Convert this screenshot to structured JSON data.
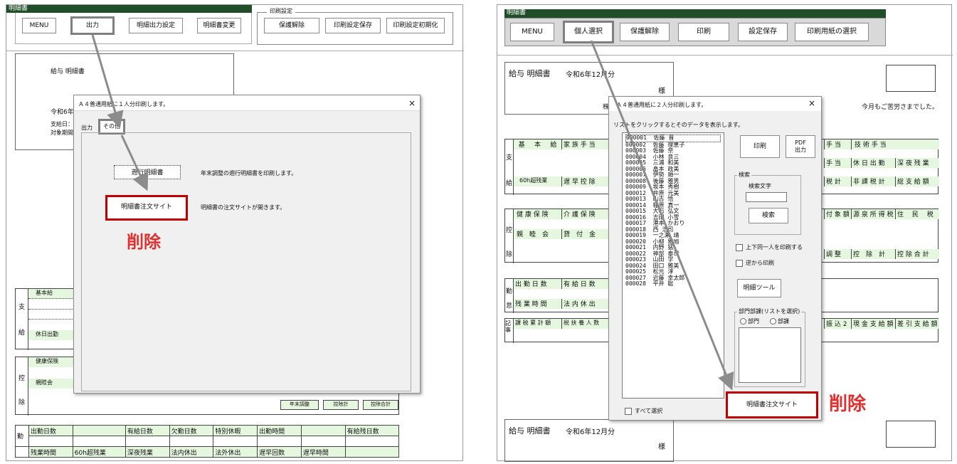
{
  "left": {
    "window_title": "明細書",
    "toolbar": {
      "menu": "MENU",
      "output": "出力",
      "meisai_output_settings": "明細出力設定",
      "meisai_change": "明細書変更"
    },
    "print_settings": {
      "title": "印刷設定",
      "unprotect": "保護解除",
      "save": "印刷設定保存",
      "reset": "印刷設定初期化"
    },
    "doc": {
      "title": "給与 明細書",
      "era": "令和6年",
      "payday": "支給日：",
      "period": "対象期間"
    },
    "dialog": {
      "title": "Ａ４普通用紙に１人分印刷します。",
      "tabs": {
        "output": "出力",
        "other": "その他"
      },
      "btn_nenmatsu": "遡行明細書",
      "desc_nenmatsu": "年末調整の遡行明細書を印刷します。",
      "btn_order": "明細書注文サイト",
      "desc_order": "明細書の注文サイトが開きます。"
    },
    "annotation": "削除",
    "table_pay": {
      "side1": "支",
      "side2": "給",
      "r1": "基本給",
      "r2": "休日出勤"
    },
    "table_ded": {
      "side1": "控",
      "side2": "除",
      "r1": "健康保険",
      "r2": "親睦会",
      "c_nenmatsu": "年末調整",
      "c_kojokei": "控除計",
      "c_kojogokei": "控除合計"
    },
    "table_att": {
      "side": "勤",
      "row1": [
        "出勤日数",
        "",
        "有給日数",
        "欠勤日数",
        "特別休暇",
        "出勤時間",
        "",
        "有給残日数"
      ],
      "row2": [
        "残業時間",
        "60h超残業",
        "深夜残業",
        "法内休出",
        "法外休出",
        "遅早回数",
        "遅早時間",
        ""
      ]
    }
  },
  "right": {
    "window_title": "明細書",
    "toolbar": {
      "menu": "MENU",
      "select": "個人選択",
      "unprotect": "保護解除",
      "print": "印刷",
      "save": "設定保存",
      "paper": "印刷用紙の選択"
    },
    "doc": {
      "title": "給与 明細書",
      "date": "令和6年12月分",
      "sama": "様",
      "co": "株式",
      "thanks": "今月もご苦労さまでした。"
    },
    "dialog": {
      "title": "Ａ４普通用紙に２人分印刷します。",
      "hint": "リストをクリックするとそのデータを表示します。",
      "employees": [
        "000001  佐藤 晋",
        "000002  佐藤 理恵子",
        "000003  佐藤 奈",
        "000004  小林 良三",
        "000005  三浦 和美",
        "000006  畠本 政美",
        "000007  伊勢 順一",
        "000008  後藤 雅男",
        "000009  坂本 秀樹",
        "000012  井原 元美",
        "000013  山古 悟",
        "000014  稲原 真一",
        "000015  大石 弘文",
        "000016  吉田 小雪",
        "000017  港本 かおり",
        "000018  西 浩司",
        "000019  一之瀬 靖",
        "000020  小柳 雅旭",
        "000021  内野 猛",
        "000022  神部 泰司",
        "000023  山田 学",
        "000024  田口 雅美",
        "000025  松元 淳",
        "000027  近藤 幸太郎",
        "000028  平井 聡"
      ],
      "print": "印刷",
      "pdf": "PDF\n出力",
      "search_group": "検索",
      "search_label": "検索文字",
      "search_btn": "検索",
      "chk_updown": "上下同一人を印刷する",
      "chk_reverse": "逆から印刷",
      "tool_btn": "明細ツール",
      "dept_group": "部門部課(リストを選択)",
      "radio_dept": "部門",
      "radio_ka": "部課",
      "select_all": "すべて選択",
      "order_btn": "明細書注文サイト"
    },
    "annotation": "削除",
    "table_pay": {
      "side1": "支",
      "side2": "給",
      "h1": [
        "基",
        "本",
        "給"
      ],
      "h1b": "家 族 手 当",
      "h1r": [
        "手 当",
        "技 術 手 当"
      ],
      "h2r": [
        "手 当",
        "休 日 出 勤",
        "深 夜 残 業"
      ],
      "h3": "60h超残業",
      "h3b": "遅 早 控 除",
      "h3r": [
        "税 計",
        "非 課 税 計",
        "総 支 給 額"
      ]
    },
    "table_ded": {
      "side1": "控",
      "side2": "除",
      "h1": "健 康 保 険",
      "h1b": "介 護 保 険",
      "h1r": [
        "付 象 額",
        "源 泉 所 得 税",
        "住　 民　 税"
      ],
      "h2": "親　睦　会",
      "h2b": "貸　付　金",
      "h3r": [
        "調 整",
        "控　除　計",
        "控 除 合 計"
      ]
    },
    "table_att": {
      "side1": "勤",
      "side2": "怠",
      "h1": "出 勤 日 数",
      "h1b": "有 給 日 数",
      "h2": "残 業 時 間",
      "h2b": "法 内 休 出"
    },
    "table_memo": {
      "side": "記事",
      "h1": "課 税 累 計 額",
      "h1b": "税 扶 養 人 数",
      "h1r": [
        "振 込 2",
        "現 金 支 給 額",
        "差 引 支 給 額"
      ]
    },
    "doc2": {
      "title": "給与 明細書",
      "date": "令和6年12月分",
      "sama": "様"
    }
  }
}
